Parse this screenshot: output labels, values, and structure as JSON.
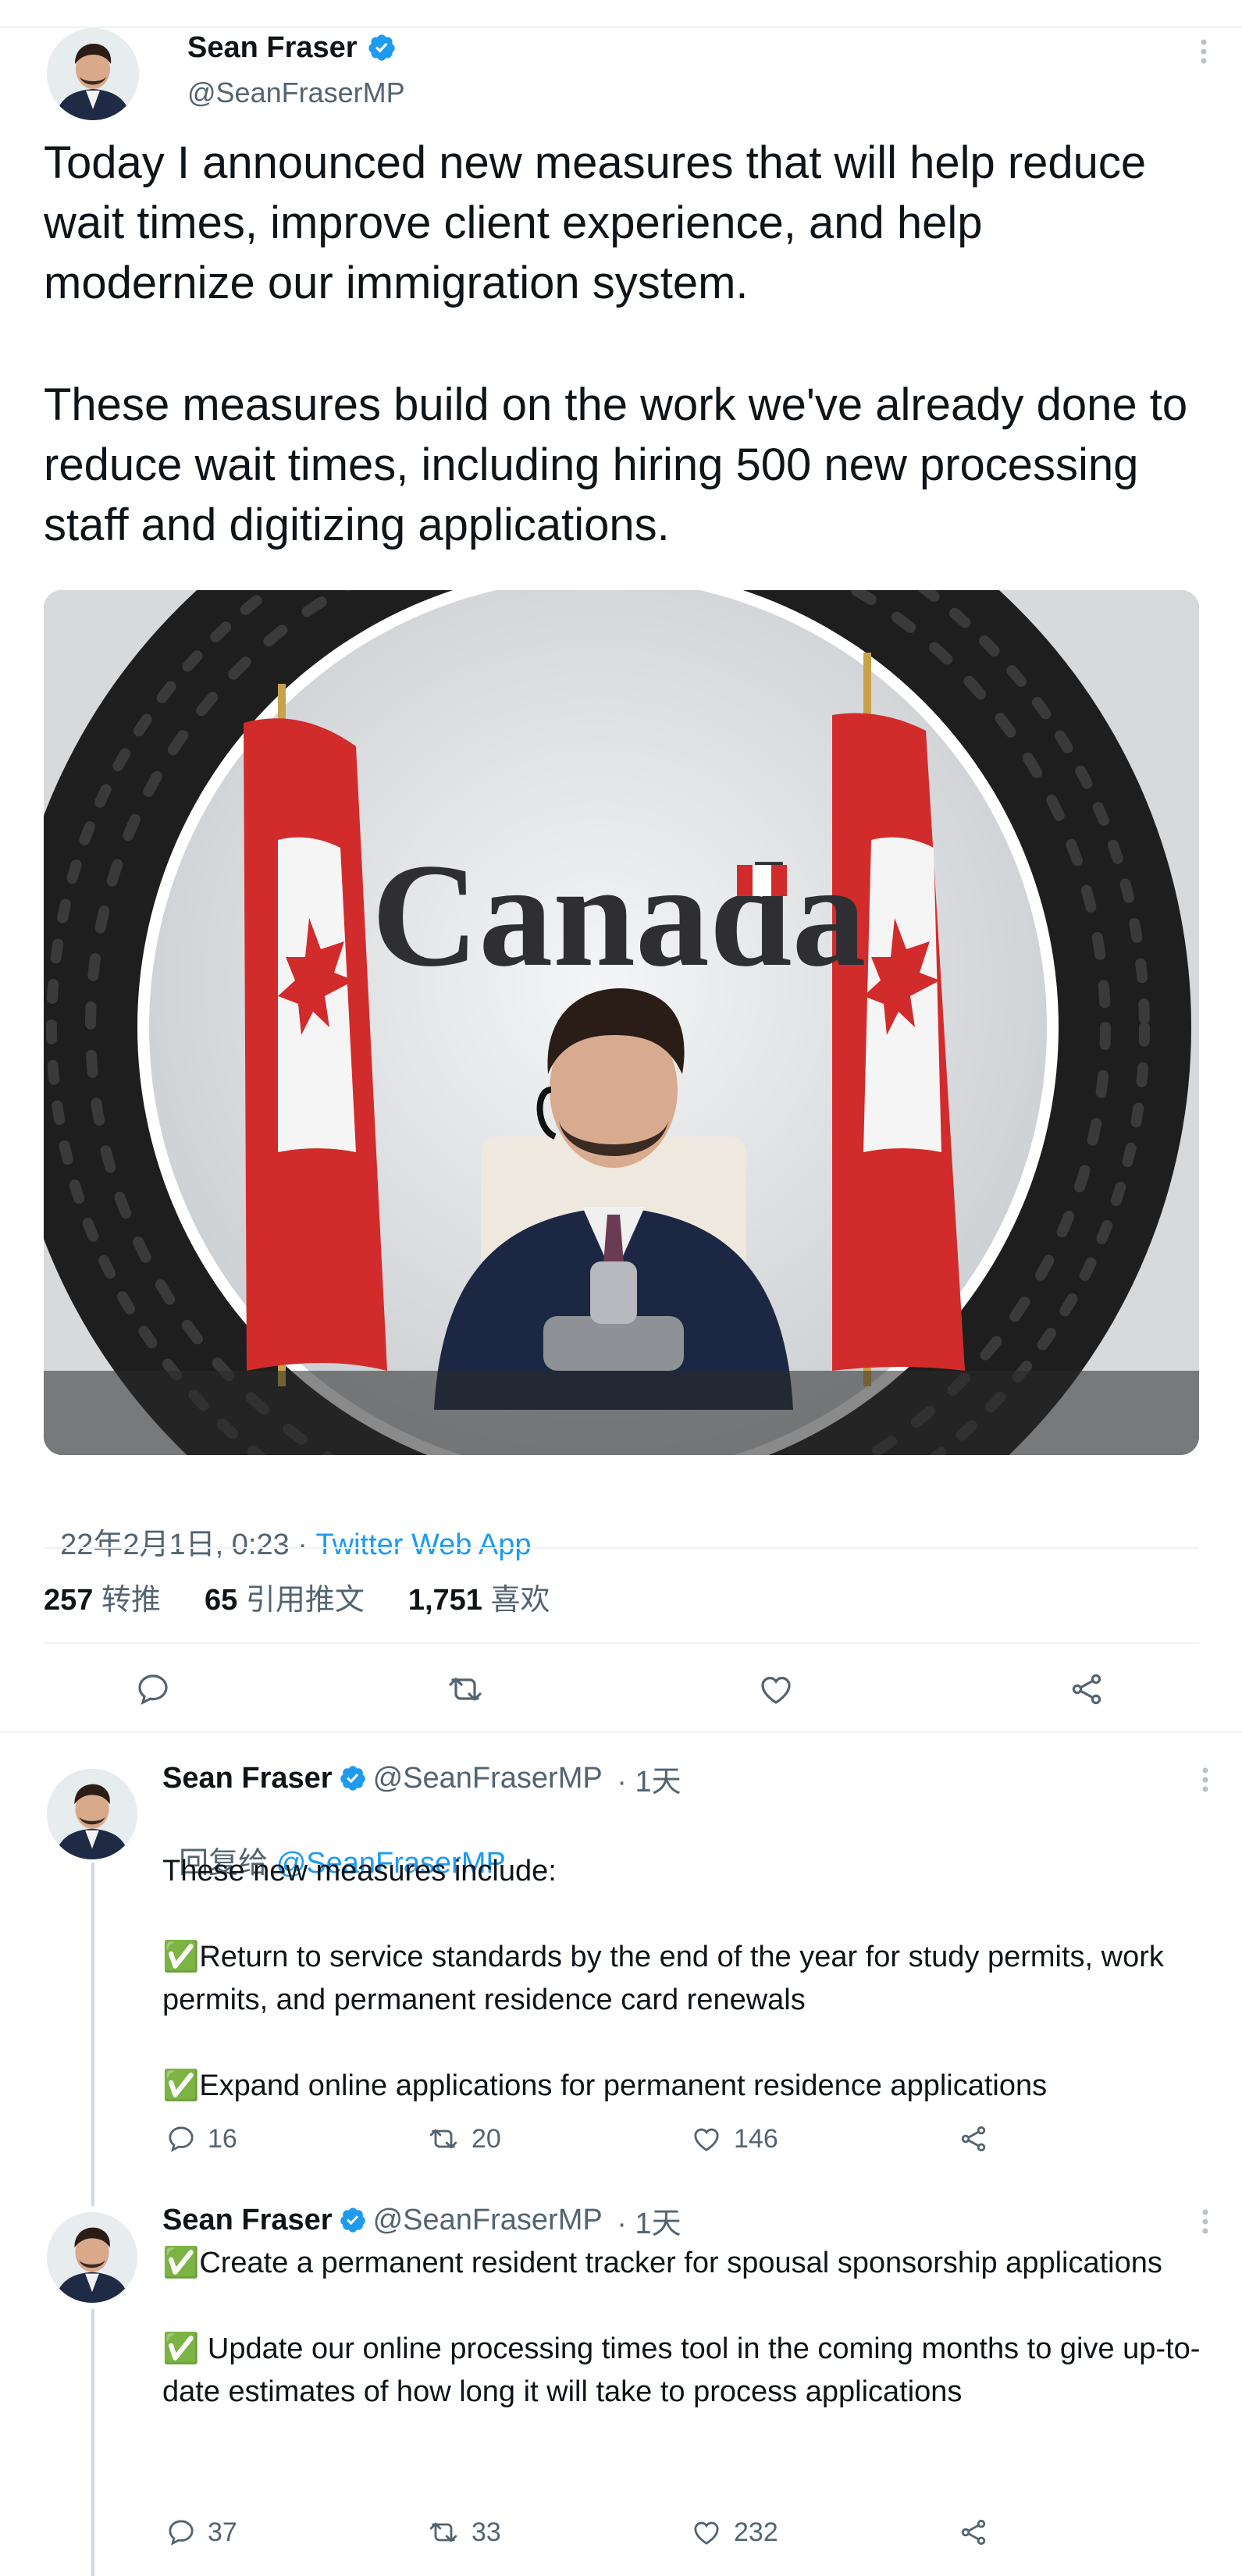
{
  "main_tweet": {
    "author_name": "Sean Fraser",
    "handle": "@SeanFraserMP",
    "paragraph_1": "Today I announced new measures that will help reduce wait times, improve client experience, and help modernize our immigration system.",
    "paragraph_2": "These measures build on the work we've already done to reduce wait times, including hiring 500 new processing staff and digitizing applications.",
    "image": {
      "sign_text": "Canada"
    },
    "timestamp": "22年2月1日, 0:23",
    "separator": " · ",
    "source": "Twitter Web App",
    "stats": {
      "retweets_count": "257",
      "retweets_label": "转推",
      "quotes_count": "65",
      "quotes_label": "引用推文",
      "likes_count": "1,751",
      "likes_label": "喜欢"
    },
    "actions": [
      "reply-icon",
      "retweet-icon",
      "like-icon",
      "share-icon"
    ]
  },
  "replies": [
    {
      "author_name": "Sean Fraser",
      "handle": "@SeanFraserMP",
      "time": " · 1天",
      "replying_to_label": "回复给",
      "replying_to_handle": "@SeanFraserMP",
      "text": "These new measures include:\n\n✅Return to service standards by the end of the year for study permits, work permits, and permanent residence card renewals\n\n✅Expand online applications for permanent residence applications",
      "replies": "16",
      "retweets": "20",
      "likes": "146"
    },
    {
      "author_name": "Sean Fraser",
      "handle": "@SeanFraserMP",
      "time": " · 1天",
      "text": "✅Create a permanent resident tracker for spousal sponsorship applications\n\n✅ Update our online processing times tool in the coming months to give up-to-date estimates of how long it will take to process applications",
      "replies": "37",
      "retweets": "33",
      "likes": "232"
    }
  ],
  "colors": {
    "accent": "#1d9bf0",
    "text": "#0f1419",
    "secondary": "#536471",
    "divider": "#eff3f4",
    "check_green": "#3aa655"
  }
}
